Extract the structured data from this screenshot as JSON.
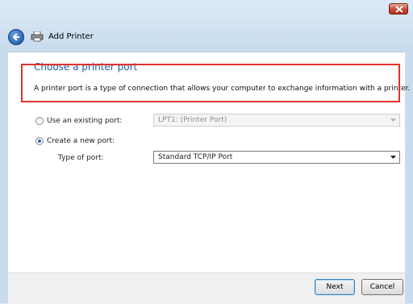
{
  "window": {
    "title": "Add Printer"
  },
  "page": {
    "heading": "Choose a printer port",
    "description": "A printer port is a type of connection that allows your computer to exchange information with a printer."
  },
  "options": {
    "existing_label": "Use an existing port:",
    "existing_value": "LPT1: (Printer Port)",
    "new_label": "Create a new port:",
    "type_label": "Type of port:",
    "type_value": "Standard TCP/IP Port"
  },
  "buttons": {
    "next": "Next",
    "cancel": "Cancel"
  },
  "colors": {
    "highlight_box": "#e0322d",
    "heading": "#1c5ea8"
  }
}
